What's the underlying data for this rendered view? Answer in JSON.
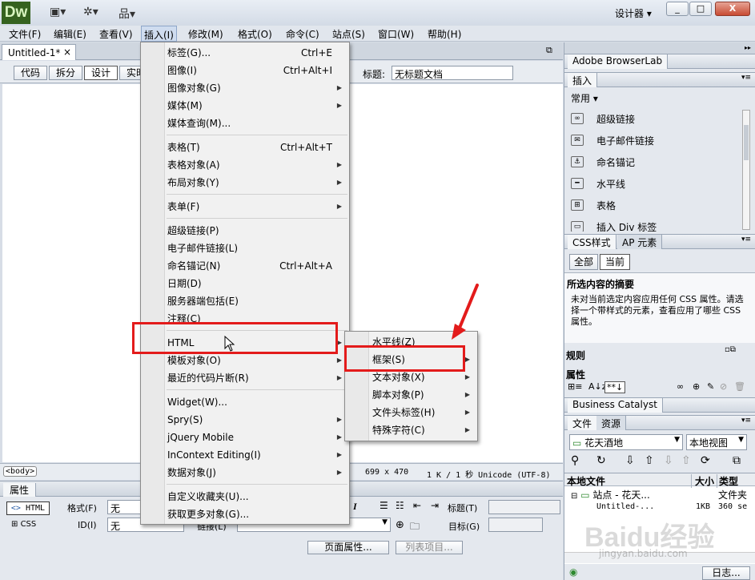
{
  "app": {
    "logo": "Dw",
    "workspace": "设计器",
    "win_minimize": "_",
    "win_restore": "□",
    "win_close": "X"
  },
  "menubar": {
    "items": [
      "文件(F)",
      "编辑(E)",
      "查看(V)",
      "插入(I)",
      "修改(M)",
      "格式(O)",
      "命令(C)",
      "站点(S)",
      "窗口(W)",
      "帮助(H)"
    ]
  },
  "doc": {
    "tab": "Untitled-1*",
    "tab_close": "×",
    "view_buttons": [
      "代码",
      "拆分",
      "设计",
      "实时"
    ],
    "title_label": "标题:",
    "title_value": "无标题文档"
  },
  "status": {
    "tag": "<body>",
    "size": "699 x 470",
    "info": "1 K / 1 秒 Unicode (UTF-8)"
  },
  "properties": {
    "header": "属性",
    "html_btn": "HTML",
    "css_btn": "CSS",
    "format_label": "格式(F)",
    "format_value": "无",
    "id_label": "ID(I)",
    "id_value": "无",
    "link_label": "链接(L)",
    "title_label": "标题(T)",
    "target_label": "目标(G)",
    "page_props_btn": "页面属性...",
    "list_item_btn": "列表项目..."
  },
  "insert_menu": {
    "items": [
      {
        "label": "标签(G)...",
        "shortcut": "Ctrl+E",
        "submenu": false
      },
      {
        "label": "图像(I)",
        "shortcut": "Ctrl+Alt+I",
        "submenu": false
      },
      {
        "label": "图像对象(G)",
        "shortcut": "",
        "submenu": true
      },
      {
        "label": "媒体(M)",
        "shortcut": "",
        "submenu": true
      },
      {
        "label": "媒体查询(M)...",
        "shortcut": "",
        "submenu": false
      },
      {
        "label": "表格(T)",
        "shortcut": "Ctrl+Alt+T",
        "submenu": false
      },
      {
        "label": "表格对象(A)",
        "shortcut": "",
        "submenu": true
      },
      {
        "label": "布局对象(Y)",
        "shortcut": "",
        "submenu": true
      },
      {
        "label": "表单(F)",
        "shortcut": "",
        "submenu": true
      },
      {
        "label": "超级链接(P)",
        "shortcut": "",
        "submenu": false
      },
      {
        "label": "电子邮件链接(L)",
        "shortcut": "",
        "submenu": false
      },
      {
        "label": "命名锚记(N)",
        "shortcut": "Ctrl+Alt+A",
        "submenu": false
      },
      {
        "label": "日期(D)",
        "shortcut": "",
        "submenu": false
      },
      {
        "label": "服务器端包括(E)",
        "shortcut": "",
        "submenu": false
      },
      {
        "label": "注释(C)",
        "shortcut": "",
        "submenu": false
      },
      {
        "label": "HTML",
        "shortcut": "",
        "submenu": true
      },
      {
        "label": "模板对象(O)",
        "shortcut": "",
        "submenu": true
      },
      {
        "label": "最近的代码片断(R)",
        "shortcut": "",
        "submenu": true
      },
      {
        "label": "Widget(W)...",
        "shortcut": "",
        "submenu": false
      },
      {
        "label": "Spry(S)",
        "shortcut": "",
        "submenu": true
      },
      {
        "label": "jQuery Mobile",
        "shortcut": "",
        "submenu": true
      },
      {
        "label": "InContext Editing(I)",
        "shortcut": "",
        "submenu": true
      },
      {
        "label": "数据对象(J)",
        "shortcut": "",
        "submenu": true
      },
      {
        "label": "自定义收藏夹(U)...",
        "shortcut": "",
        "submenu": false
      },
      {
        "label": "获取更多对象(G)...",
        "shortcut": "",
        "submenu": false
      }
    ]
  },
  "html_submenu": {
    "items": [
      {
        "label": "水平线(Z)",
        "submenu": false
      },
      {
        "label": "框架(S)",
        "submenu": true
      },
      {
        "label": "文本对象(X)",
        "submenu": true
      },
      {
        "label": "脚本对象(P)",
        "submenu": true
      },
      {
        "label": "文件头标签(H)",
        "submenu": true
      },
      {
        "label": "特殊字符(C)",
        "submenu": true
      }
    ]
  },
  "right_panel": {
    "browserlab": "Adobe BrowserLab",
    "insert_tab": "插入",
    "category": "常用",
    "insert_items": [
      {
        "icon": "hyperlink-icon",
        "label": "超级链接"
      },
      {
        "icon": "email-icon",
        "label": "电子邮件链接"
      },
      {
        "icon": "anchor-icon",
        "label": "命名锚记"
      },
      {
        "icon": "hr-icon",
        "label": "水平线"
      },
      {
        "icon": "table-icon",
        "label": "表格"
      },
      {
        "icon": "div-icon",
        "label": "插入 Div 标签"
      }
    ],
    "css_tab": "CSS样式",
    "ap_tab": "AP 元素",
    "all_btn": "全部",
    "current_btn": "当前",
    "summary_title": "所选内容的摘要",
    "summary_text": "未对当前选定内容应用任何 CSS 属性。请选择一个带样式的元素，查看应用了哪些 CSS 属性。",
    "rules_label": "规则",
    "props_label": "属性",
    "bc_tab": "Business Catalyst",
    "files_tab": "文件",
    "assets_tab": "资源",
    "site_name": "花天酒地",
    "view_select": "本地视图",
    "col_local": "本地文件",
    "col_size": "大小",
    "col_type": "类型",
    "site_row": "站点 - 花天...",
    "site_type": "文件夹",
    "file_row": "Untitled-...",
    "file_size": "1KB",
    "file_type": "360 se",
    "log_btn": "日志..."
  },
  "watermark": {
    "main": "Baidu经验",
    "sub": "jingyan.baidu.com"
  }
}
